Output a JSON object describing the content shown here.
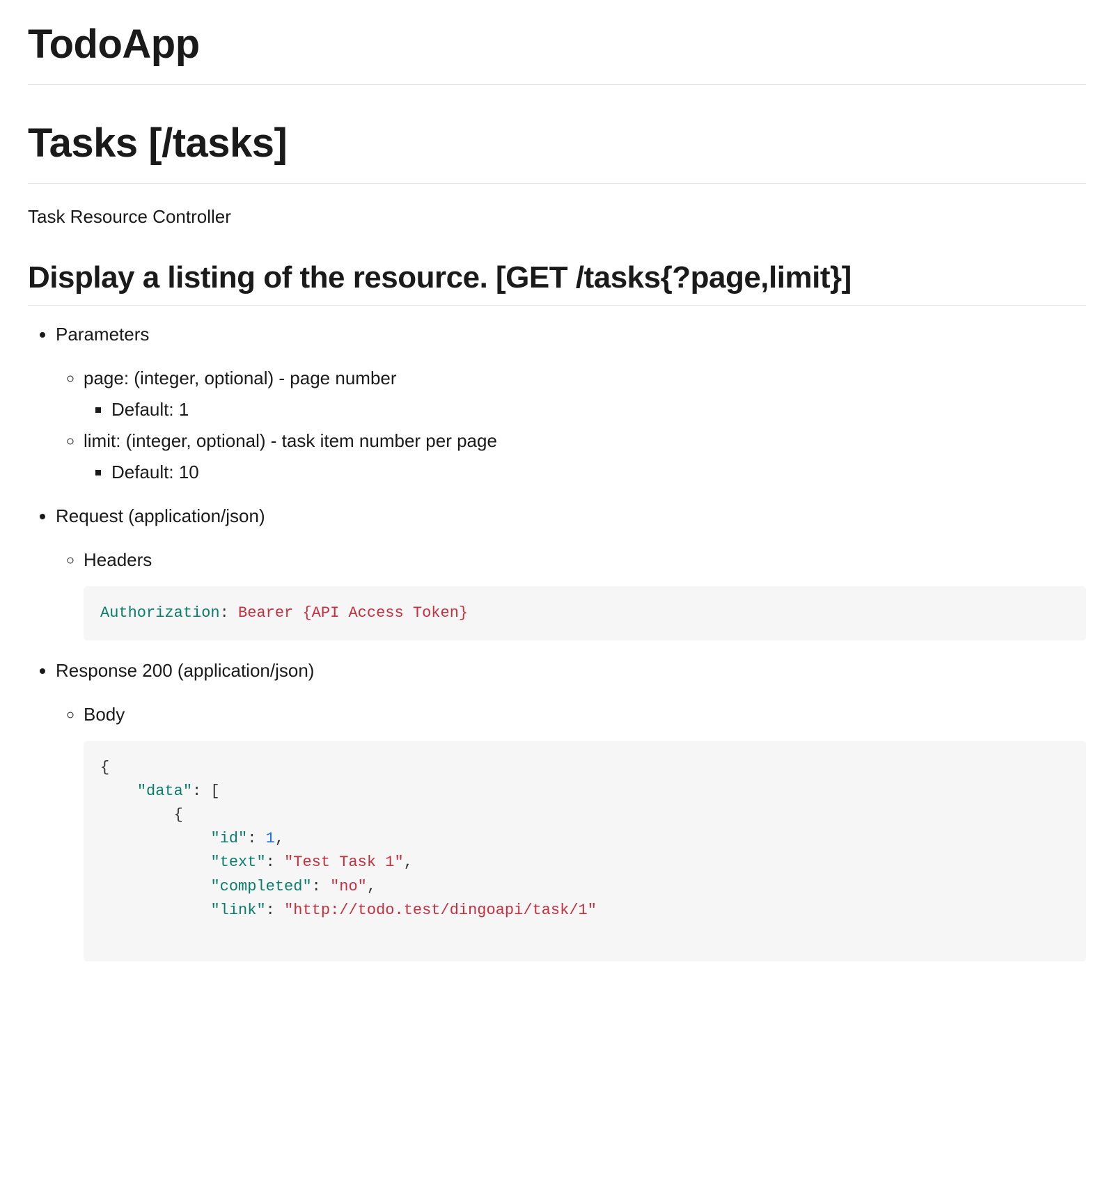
{
  "app_title": "TodoApp",
  "section_title": "Tasks [/tasks]",
  "section_subtitle": "Task Resource Controller",
  "endpoint_title": "Display a listing of the resource. [GET /tasks{?page,limit}]",
  "labels": {
    "parameters": "Parameters",
    "request": "Request (application/json)",
    "headers": "Headers",
    "response": "Response 200 (application/json)",
    "body": "Body"
  },
  "parameters": [
    {
      "line": "page: (integer, optional) - page number",
      "default_line": "Default: 1"
    },
    {
      "line": "limit: (integer, optional) - task item number per page",
      "default_line": "Default: 10"
    }
  ],
  "headers_code": {
    "name": "Authorization",
    "sep": ": ",
    "value": "Bearer {API Access Token}"
  },
  "body_json": {
    "data": [
      {
        "id": 1,
        "text": "Test Task 1",
        "completed": "no",
        "link": "http://todo.test/dingoapi/task/1"
      }
    ]
  }
}
